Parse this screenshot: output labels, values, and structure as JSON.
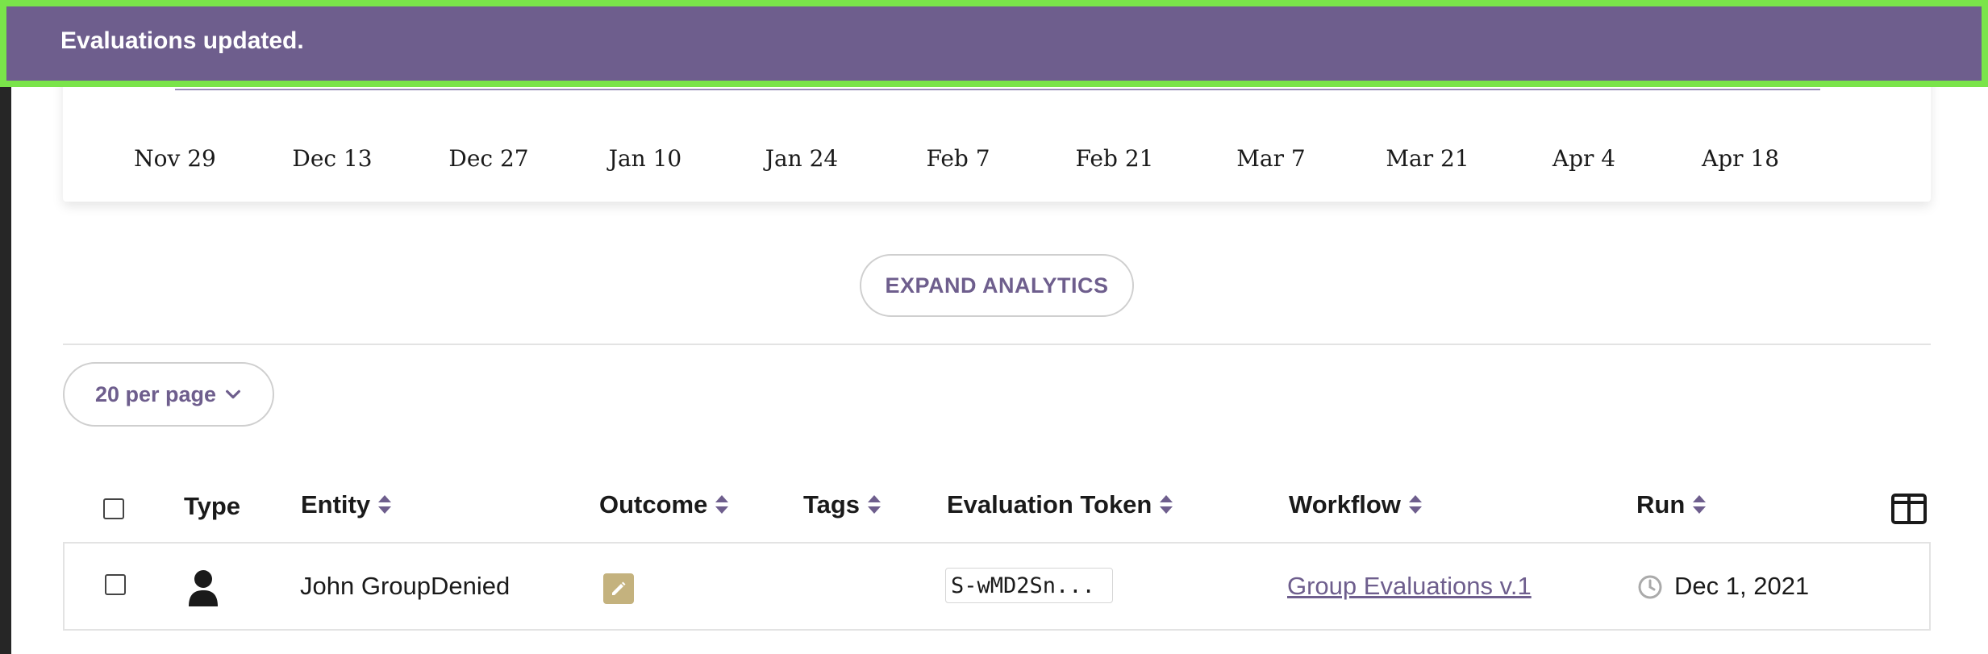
{
  "notification": {
    "message": "Evaluations updated."
  },
  "chart": {
    "x_ticks": [
      "Nov 29",
      "Dec 13",
      "Dec 27",
      "Jan 10",
      "Jan 24",
      "Feb 7",
      "Feb 21",
      "Mar 7",
      "Mar 21",
      "Apr 4",
      "Apr 18"
    ]
  },
  "analytics": {
    "expand_label": "EXPAND ANALYTICS"
  },
  "pagination": {
    "per_page_label": "20 per page"
  },
  "table": {
    "columns": {
      "type": "Type",
      "entity": "Entity",
      "outcome": "Outcome",
      "tags": "Tags",
      "token": "Evaluation Token",
      "workflow": "Workflow",
      "run": "Run"
    },
    "rows": [
      {
        "entity": "John GroupDenied",
        "token": "S-wMD2Sn...",
        "workflow": "Group Evaluations v.1",
        "run": "Dec 1, 2021"
      }
    ]
  },
  "colors": {
    "accent": "#6e5e8d",
    "toast_border": "#7ae44a",
    "outcome_badge": "#c4b27e"
  },
  "icons": {
    "entity_type": "person-icon",
    "outcome": "pencil-icon",
    "run_time": "clock-icon",
    "columns": "columns-icon",
    "sort": "sort-icon",
    "per_page": "chevron-down-icon"
  }
}
